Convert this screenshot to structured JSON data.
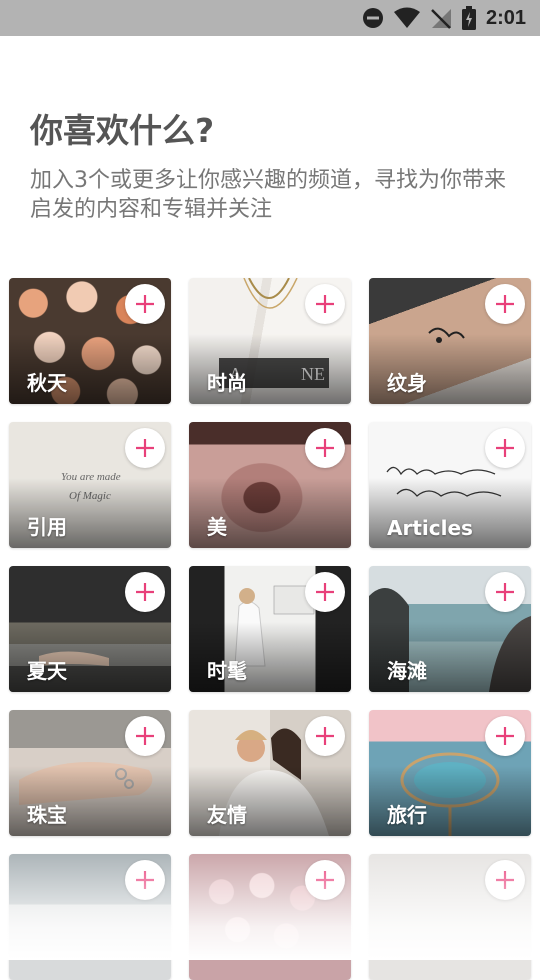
{
  "status_bar": {
    "time": "2:01",
    "icons": [
      "do-not-disturb-icon",
      "wifi-icon",
      "no-signal-icon",
      "battery-charging-icon"
    ]
  },
  "header": {
    "title": "你喜欢什么?",
    "subtitle": "加入3个或更多让你感兴趣的频道，寻找为你带来启发的内容和专辑并关注"
  },
  "topics": [
    {
      "label": "秋天"
    },
    {
      "label": "时尚"
    },
    {
      "label": "纹身"
    },
    {
      "label": "引用"
    },
    {
      "label": "美"
    },
    {
      "label": "Articles"
    },
    {
      "label": "夏天"
    },
    {
      "label": "时髦"
    },
    {
      "label": "海滩"
    },
    {
      "label": "珠宝"
    },
    {
      "label": "友情"
    },
    {
      "label": "旅行"
    },
    {
      "label": ""
    },
    {
      "label": ""
    },
    {
      "label": ""
    }
  ],
  "colors": {
    "accent": "#e8407a",
    "title": "#555555",
    "subtitle": "#777777"
  }
}
